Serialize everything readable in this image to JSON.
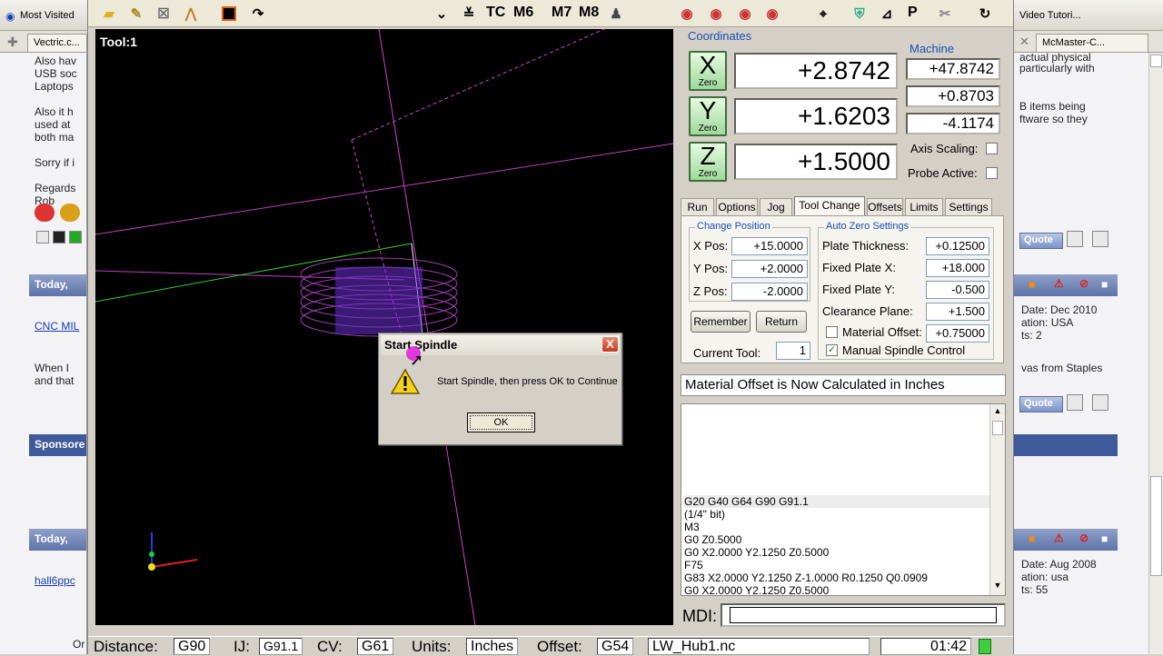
{
  "browser": {
    "bookmark_most_visited": "Most Visited",
    "bookmark_right": "Video Tutori...",
    "tab_left": "Vectric.c...",
    "tab_right": "McMaster-C...",
    "left_text": [
      "Also hav",
      "USB soc",
      "Laptops",
      "",
      "Also it h",
      "used at",
      "both ma",
      "",
      "Sorry if i",
      "",
      "Regards",
      "Rob"
    ],
    "left_head_1": "Today,",
    "left_link_1": "CNC MIL",
    "left_text_2": [
      "When I",
      "and that"
    ],
    "left_sponsor": "Sponsore",
    "left_head_2": "Today,",
    "left_link_2": "hall6ppc",
    "left_bottom": "Or",
    "right_text_1": [
      "actual physical",
      "particularly with",
      "",
      "",
      "B items being",
      "ftware so they"
    ],
    "right_quote": "Quote",
    "right_info_1": [
      "Date: Dec 2010",
      "ation: USA",
      "ts: 2"
    ],
    "right_text_2": "vas from Staples",
    "right_info_2": [
      "Date: Aug 2008",
      "ation: usa",
      "ts: 55"
    ]
  },
  "toolbar": {
    "tc": "TC",
    "m6": "M6",
    "m7": "M7",
    "m8": "M8",
    "p": "P"
  },
  "viewport": {
    "tool_label": "Tool:1"
  },
  "coordinates": {
    "title": "Coordinates",
    "machine_title": "Machine",
    "axes": [
      {
        "letter": "X",
        "zero_label": "Zero",
        "value": "+2.8742",
        "machine": "+47.8742"
      },
      {
        "letter": "Y",
        "zero_label": "Zero",
        "value": "+1.6203",
        "machine": "+0.8703"
      },
      {
        "letter": "Z",
        "zero_label": "Zero",
        "value": "+1.5000",
        "machine": "-4.1174"
      }
    ],
    "axis_scaling": "Axis Scaling:",
    "probe_active": "Probe Active:"
  },
  "tabs": [
    "Run",
    "Options",
    "Jog",
    "Tool Change",
    "Offsets",
    "Limits",
    "Settings"
  ],
  "tool_change": {
    "change_position_title": "Change Position",
    "x_pos_label": "X Pos:",
    "x_pos": "+15.0000",
    "y_pos_label": "Y Pos:",
    "y_pos": "+2.0000",
    "z_pos_label": "Z Pos:",
    "z_pos": "-2.0000",
    "remember": "Remember",
    "return": "Return",
    "current_tool_label": "Current Tool:",
    "current_tool": "1",
    "auto_zero_title": "Auto Zero Settings",
    "plate_thickness_label": "Plate Thickness:",
    "plate_thickness": "+0.12500",
    "fixed_x_label": "Fixed Plate X:",
    "fixed_x": "+18.000",
    "fixed_y_label": "Fixed Plate Y:",
    "fixed_y": "-0.500",
    "clearance_label": "Clearance Plane:",
    "clearance": "+1.500",
    "material_offset_label": "Material Offset:",
    "material_offset": "+0.75000",
    "manual_spindle_label": "Manual Spindle Control",
    "manual_spindle_check": "✓"
  },
  "status_message": "Material Offset is Now Calculated in Inches",
  "gcode_lines": [
    "G20 G40 G64 G90 G91.1",
    "(1/4\" bit)",
    "M3",
    "G0 Z0.5000",
    "G0 X2.0000 Y2.1250 Z0.5000",
    "F75",
    "G83 X2.0000 Y2.1250 Z-1.0000 R0.1250 Q0.0909",
    "G0 X2.0000 Y2.1250 Z0.5000"
  ],
  "mdi_label": "MDI:",
  "statusbar": {
    "distance_label": "Distance:",
    "distance": "G90",
    "ij_label": "IJ:",
    "ij": "G91.1",
    "cv_label": "CV:",
    "cv": "G61",
    "units_label": "Units:",
    "units": "Inches",
    "offset_label": "Offset:",
    "offset": "G54",
    "file": "LW_Hub1.nc",
    "time": "01:42"
  },
  "dialog": {
    "title": "Start Spindle",
    "close": "X",
    "message": "Start Spindle, then press OK to Continue",
    "ok": "OK"
  },
  "colors": {
    "accent_blue": "#1b4fb0",
    "axis_green": "#9ed99a",
    "viewport_bg": "#000000",
    "toolpath_magenta": "#c43ccf",
    "cursor_highlight": "#e21be0"
  }
}
